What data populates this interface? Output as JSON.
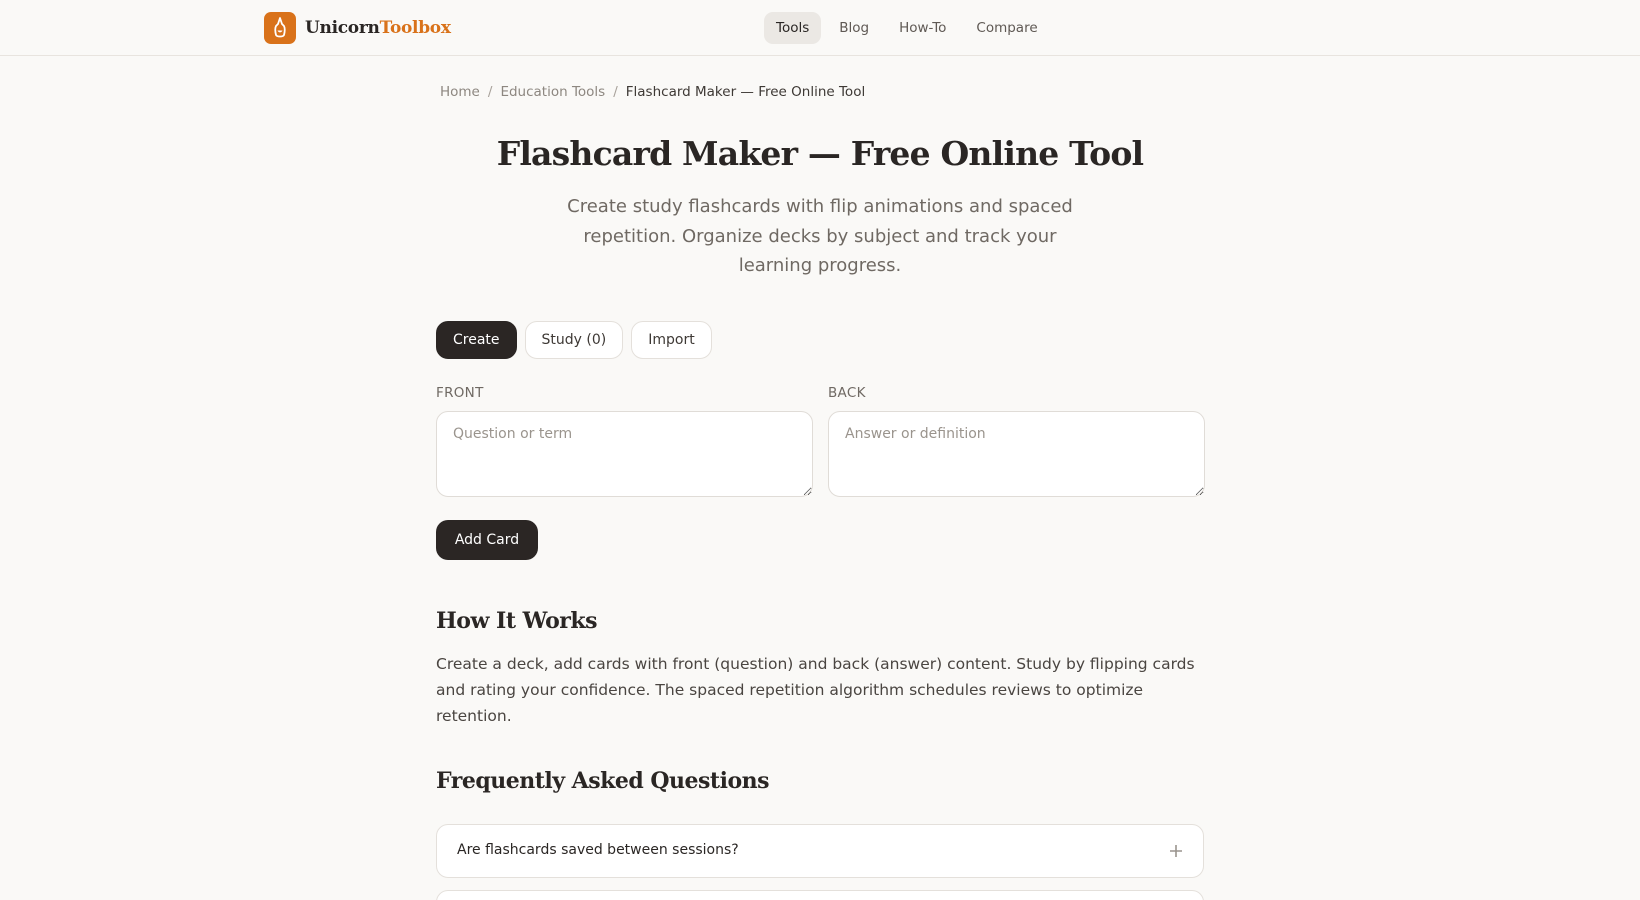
{
  "header": {
    "logo": {
      "part1": "Unicorn",
      "part2": "Toolbox"
    },
    "nav": [
      {
        "label": "Tools",
        "active": true
      },
      {
        "label": "Blog"
      },
      {
        "label": "How-To"
      },
      {
        "label": "Compare"
      }
    ]
  },
  "breadcrumb": {
    "home": "Home",
    "category": "Education Tools",
    "current": "Flashcard Maker — Free Online Tool",
    "separator": "/"
  },
  "page": {
    "title": "Flashcard Maker — Free Online Tool",
    "subtitle": "Create study flashcards with flip animations and spaced repetition. Organize decks by subject and track your learning progress."
  },
  "tabs": [
    {
      "label": "Create",
      "active": true
    },
    {
      "label": "Study (0)"
    },
    {
      "label": "Import"
    }
  ],
  "form": {
    "front_label": "FRONT",
    "front_placeholder": "Question or term",
    "back_label": "BACK",
    "back_placeholder": "Answer or definition",
    "add_button": "Add Card"
  },
  "how_it_works": {
    "heading": "How It Works",
    "text": "Create a deck, add cards with front (question) and back (answer) content. Study by flipping cards and rating your confidence. The spaced repetition algorithm schedules reviews to optimize retention."
  },
  "faq": {
    "heading": "Frequently Asked Questions",
    "items": [
      {
        "question": "Are flashcards saved between sessions?",
        "expand_icon": "plus-icon"
      },
      {
        "question": "",
        "expand_icon": "plus-icon"
      }
    ]
  },
  "colors": {
    "accent": "#d9721a",
    "dark_button": "#2b2624",
    "background": "#faf9f7"
  }
}
